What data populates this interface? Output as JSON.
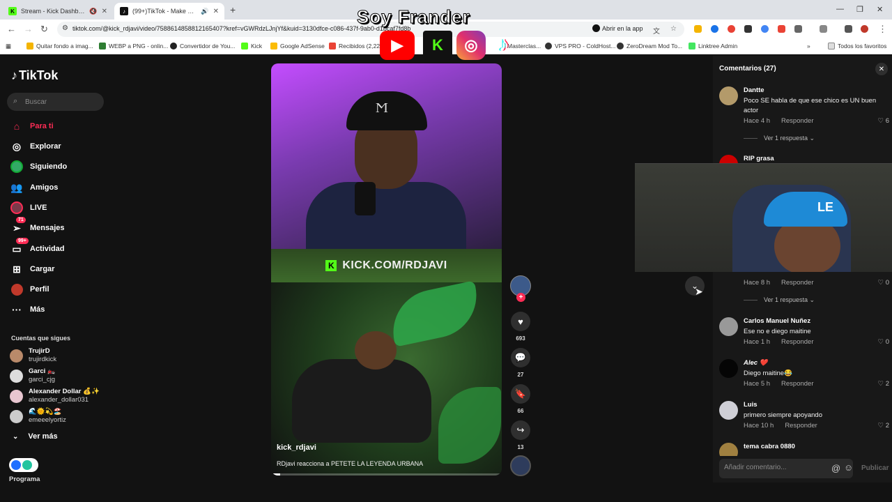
{
  "browser": {
    "tabs": [
      {
        "title": "Stream - Kick Dashboard",
        "favicon": "kick-icon"
      },
      {
        "title": "(99+)TikTok - Make Your Da",
        "favicon": "tiktok-icon"
      }
    ],
    "url": "tiktok.com/@kick_rdjavi/video/7588614858812165407?kref=vGWRdzLJnjYf&kuid=3130dfce-c086-437f-9ab0-d1bcaf7fd8b",
    "open_in_app": "Abrir en la app",
    "bookmarks": [
      "Quitar fondo a imag...",
      "WEBP a PNG - onlin...",
      "Convertidor de You...",
      "Kick",
      "Google AdSense",
      "Recibidos (2,229)",
      "Masterclas...",
      "VPS PRO - ColdHost...",
      "ZeroDream Mod To...",
      "Linktree Admin"
    ],
    "all_bookmarks": "Todos los favoritos"
  },
  "tiktok": {
    "logo": "TikTok",
    "search_placeholder": "Buscar",
    "nav": [
      {
        "label": "Para ti",
        "icon": "home-icon",
        "active": true
      },
      {
        "label": "Explorar",
        "icon": "compass-icon"
      },
      {
        "label": "Siguiendo",
        "icon": "following-icon"
      },
      {
        "label": "Amigos",
        "icon": "friends-icon"
      },
      {
        "label": "LIVE",
        "icon": "live-icon"
      },
      {
        "label": "Mensajes",
        "icon": "messages-icon",
        "badge": "71"
      },
      {
        "label": "Actividad",
        "icon": "activity-icon",
        "badge": "99+"
      },
      {
        "label": "Cargar",
        "icon": "upload-icon"
      },
      {
        "label": "Perfil",
        "icon": "profile-icon"
      },
      {
        "label": "Más",
        "icon": "more-icon"
      }
    ],
    "following_title": "Cuentas que sigues",
    "following": [
      {
        "name": "TrujirD",
        "user": "trujirdkick"
      },
      {
        "name": "Garci 🏍️",
        "user": "garci_cjg"
      },
      {
        "name": "Alexander Dollar 💰✨",
        "user": "alexander_dollar031"
      },
      {
        "name": "🌊🌞💫🏖️",
        "user": "emeeelyortiz"
      }
    ],
    "see_more": "Ver más",
    "program": "Programa"
  },
  "video": {
    "kick_url": "KICK.COM/RDJAVI",
    "author": "kick_rdjavi",
    "description": "RDjavi reacciona a PETETE LA LEYENDA URBANA",
    "progress": 0.04,
    "likes": "693",
    "comments": "27",
    "saves": "66",
    "shares": "13"
  },
  "comments": {
    "title": "Comentarios (27)",
    "items": [
      {
        "name": "Dantte",
        "text": "Poco SE habla de que ese chico es UN buen actor",
        "time": "Hace 4 h",
        "reply": "Responder",
        "likes": "6",
        "replies": "Ver 1 respuesta"
      },
      {
        "name": "RIP grasa",
        "time": "Hace 8 h",
        "reply": "Responder",
        "likes": "0",
        "replies": "Ver 1 respuesta"
      },
      {
        "name": "Carlos Manuel Nuñez",
        "text": "Ese no e diego maitine",
        "time": "Hace 1 h",
        "reply": "Responder",
        "likes": "0"
      },
      {
        "name": "Alec ❤️",
        "text": "Diego maitine😂",
        "time": "Hace 5 h",
        "reply": "Responder",
        "likes": "2"
      },
      {
        "name": "Luis",
        "text": "primero siempre apoyando",
        "time": "Hace 10 h",
        "reply": "Responder",
        "likes": "2"
      },
      {
        "name": "tema cabra 0880"
      }
    ],
    "input_placeholder": "Añadir comentario...",
    "post": "Publicar"
  },
  "overlay": {
    "title": "Soy Frander"
  },
  "colors": {
    "accent": "#fe2c55",
    "kick_green": "#53fc18",
    "panel": "#181818",
    "background": "#121212"
  }
}
